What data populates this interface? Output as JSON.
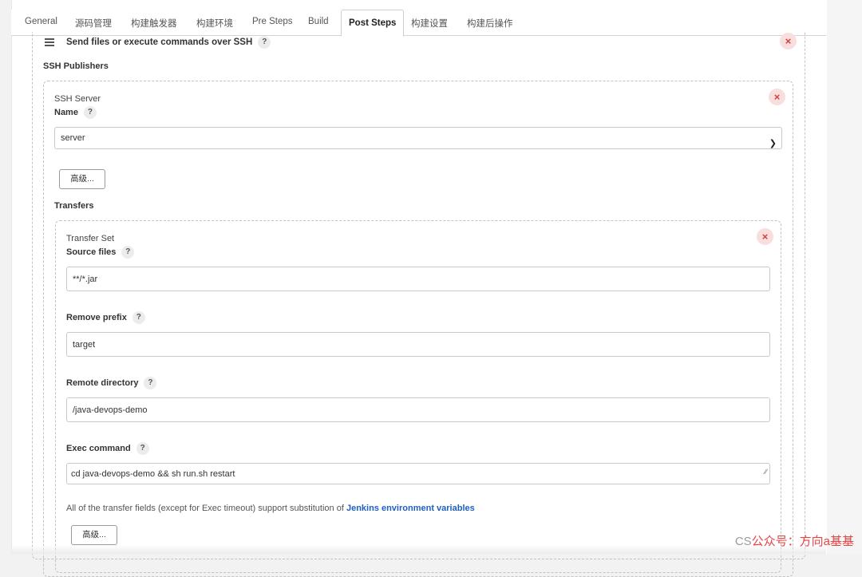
{
  "tabs": [
    {
      "label": "General",
      "active": false
    },
    {
      "label": "源码管理",
      "active": false
    },
    {
      "label": "构建触发器",
      "active": false
    },
    {
      "label": "构建环境",
      "active": false
    },
    {
      "label": "Pre Steps",
      "active": false
    },
    {
      "label": "Build",
      "active": false
    },
    {
      "label": "Post Steps",
      "active": true
    },
    {
      "label": "构建设置",
      "active": false
    },
    {
      "label": "构建后操作",
      "active": false
    }
  ],
  "step": {
    "title": "Send files or execute commands over SSH",
    "help": "?",
    "close": "×",
    "publishers_label": "SSH Publishers"
  },
  "ssh_server": {
    "section_label": "SSH Server",
    "name_label": "Name",
    "name_value": "server",
    "advanced_button": "高级...",
    "close": "×",
    "transfers_label": "Transfers"
  },
  "transfer_set": {
    "section_label": "Transfer Set",
    "close": "×",
    "source_files_label": "Source files",
    "source_files_value": "**/*.jar",
    "remove_prefix_label": "Remove prefix",
    "remove_prefix_value": "target",
    "remote_directory_label": "Remote directory",
    "remote_directory_value": "/java-devops-demo",
    "exec_command_label": "Exec command",
    "exec_command_value": "cd java-devops-demo && sh run.sh restart",
    "note_text": "All of the transfer fields (except for Exec timeout) support substitution of ",
    "note_link": "Jenkins environment variables",
    "advanced_button": "高级..."
  },
  "watermark": {
    "prefix": "CS",
    "text": "公众号：方向a基基"
  },
  "colors": {
    "close_bg": "#f9dede",
    "close_fg": "#d43f3f",
    "link": "#1f5fc0",
    "watermark": "#e64545"
  }
}
